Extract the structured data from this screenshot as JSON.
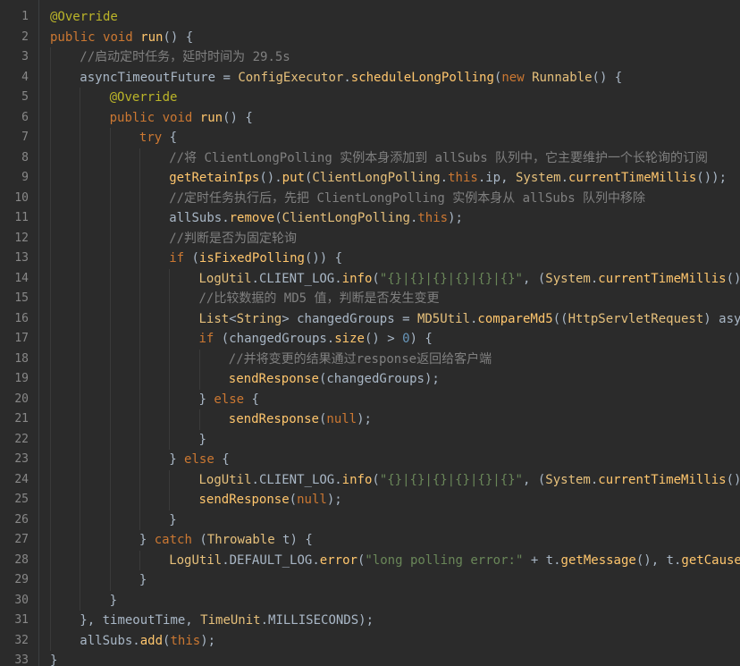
{
  "editor": {
    "colors": {
      "background": "#2b2b2b",
      "keyword": "#cc7832",
      "string": "#6a8759",
      "number": "#6897bb",
      "comment": "#808080",
      "method": "#ffc66d",
      "plain": "#a9b7c6"
    },
    "lines": [
      {
        "n": "1",
        "indent": 0,
        "tokens": [
          [
            "ann",
            "@Override"
          ]
        ]
      },
      {
        "n": "2",
        "indent": 0,
        "tokens": [
          [
            "kw",
            "public "
          ],
          [
            "kw",
            "void "
          ],
          [
            "fn",
            "run"
          ],
          [
            "pl",
            "() {"
          ]
        ]
      },
      {
        "n": "3",
        "indent": 1,
        "tokens": [
          [
            "cmt",
            "//启动定时任务，延时时间为 29.5s"
          ]
        ]
      },
      {
        "n": "4",
        "indent": 1,
        "tokens": [
          [
            "pl",
            "asyncTimeoutFuture = "
          ],
          [
            "cls",
            "ConfigExecutor"
          ],
          [
            "pl",
            "."
          ],
          [
            "fn",
            "scheduleLongPolling"
          ],
          [
            "pl",
            "("
          ],
          [
            "kw",
            "new "
          ],
          [
            "cls",
            "Runnable"
          ],
          [
            "pl",
            "() {"
          ]
        ]
      },
      {
        "n": "5",
        "indent": 2,
        "tokens": [
          [
            "ann",
            "@Override"
          ]
        ]
      },
      {
        "n": "6",
        "indent": 2,
        "tokens": [
          [
            "kw",
            "public "
          ],
          [
            "kw",
            "void "
          ],
          [
            "fn",
            "run"
          ],
          [
            "pl",
            "() {"
          ]
        ]
      },
      {
        "n": "7",
        "indent": 3,
        "tokens": [
          [
            "kw",
            "try "
          ],
          [
            "pl",
            "{"
          ]
        ]
      },
      {
        "n": "8",
        "indent": 4,
        "tokens": [
          [
            "cmt",
            "//将 ClientLongPolling 实例本身添加到 allSubs 队列中，它主要维护一个长轮询的订阅"
          ]
        ]
      },
      {
        "n": "9",
        "indent": 4,
        "tokens": [
          [
            "fn",
            "getRetainIps"
          ],
          [
            "pl",
            "()."
          ],
          [
            "fn",
            "put"
          ],
          [
            "pl",
            "("
          ],
          [
            "cls",
            "ClientLongPolling"
          ],
          [
            "pl",
            "."
          ],
          [
            "kw",
            "this"
          ],
          [
            "pl",
            ".ip, "
          ],
          [
            "cls",
            "System"
          ],
          [
            "pl",
            "."
          ],
          [
            "fn",
            "currentTimeMillis"
          ],
          [
            "pl",
            "());"
          ]
        ]
      },
      {
        "n": "10",
        "indent": 4,
        "tokens": [
          [
            "cmt",
            "//定时任务执行后，先把 ClientLongPolling 实例本身从 allSubs 队列中移除"
          ]
        ]
      },
      {
        "n": "11",
        "indent": 4,
        "tokens": [
          [
            "pl",
            "allSubs."
          ],
          [
            "fn",
            "remove"
          ],
          [
            "pl",
            "("
          ],
          [
            "cls",
            "ClientLongPolling"
          ],
          [
            "pl",
            "."
          ],
          [
            "kw",
            "this"
          ],
          [
            "pl",
            ");"
          ]
        ]
      },
      {
        "n": "12",
        "indent": 4,
        "tokens": [
          [
            "cmt",
            "//判断是否为固定轮询"
          ]
        ]
      },
      {
        "n": "13",
        "indent": 4,
        "tokens": [
          [
            "kw",
            "if "
          ],
          [
            "pl",
            "("
          ],
          [
            "fn",
            "isFixedPolling"
          ],
          [
            "pl",
            "()) {"
          ]
        ]
      },
      {
        "n": "14",
        "indent": 5,
        "tokens": [
          [
            "cls",
            "LogUtil"
          ],
          [
            "pl",
            ".CLIENT_LOG."
          ],
          [
            "fn",
            "info"
          ],
          [
            "pl",
            "("
          ],
          [
            "str",
            "\"{}|{}|{}|{}|{}|{}\""
          ],
          [
            "pl",
            ", ("
          ],
          [
            "cls",
            "System"
          ],
          [
            "pl",
            "."
          ],
          [
            "fn",
            "currentTimeMillis"
          ],
          [
            "pl",
            "() -"
          ]
        ]
      },
      {
        "n": "15",
        "indent": 5,
        "tokens": [
          [
            "cmt",
            "//比较数据的 MD5 值，判断是否发生变更"
          ]
        ]
      },
      {
        "n": "16",
        "indent": 5,
        "tokens": [
          [
            "cls",
            "List"
          ],
          [
            "pl",
            "<"
          ],
          [
            "cls",
            "String"
          ],
          [
            "pl",
            "> changedGroups = "
          ],
          [
            "cls",
            "MD5Util"
          ],
          [
            "pl",
            "."
          ],
          [
            "fn",
            "compareMd5"
          ],
          [
            "pl",
            "(("
          ],
          [
            "cls",
            "HttpServletRequest"
          ],
          [
            "pl",
            ") async"
          ]
        ]
      },
      {
        "n": "17",
        "indent": 5,
        "tokens": [
          [
            "kw",
            "if "
          ],
          [
            "pl",
            "(changedGroups."
          ],
          [
            "fn",
            "size"
          ],
          [
            "pl",
            "() > "
          ],
          [
            "num",
            "0"
          ],
          [
            "pl",
            ") {"
          ]
        ]
      },
      {
        "n": "18",
        "indent": 6,
        "tokens": [
          [
            "cmt",
            "//并将变更的结果通过response返回给客户端"
          ]
        ]
      },
      {
        "n": "19",
        "indent": 6,
        "tokens": [
          [
            "fn",
            "sendResponse"
          ],
          [
            "pl",
            "(changedGroups);"
          ]
        ]
      },
      {
        "n": "20",
        "indent": 5,
        "tokens": [
          [
            "pl",
            "} "
          ],
          [
            "kw",
            "else "
          ],
          [
            "pl",
            "{"
          ]
        ]
      },
      {
        "n": "21",
        "indent": 6,
        "tokens": [
          [
            "fn",
            "sendResponse"
          ],
          [
            "pl",
            "("
          ],
          [
            "kw",
            "null"
          ],
          [
            "pl",
            ");"
          ]
        ]
      },
      {
        "n": "22",
        "indent": 5,
        "tokens": [
          [
            "pl",
            "}"
          ]
        ]
      },
      {
        "n": "23",
        "indent": 4,
        "tokens": [
          [
            "pl",
            "} "
          ],
          [
            "kw",
            "else "
          ],
          [
            "pl",
            "{"
          ]
        ]
      },
      {
        "n": "24",
        "indent": 5,
        "tokens": [
          [
            "cls",
            "LogUtil"
          ],
          [
            "pl",
            ".CLIENT_LOG."
          ],
          [
            "fn",
            "info"
          ],
          [
            "pl",
            "("
          ],
          [
            "str",
            "\"{}|{}|{}|{}|{}|{}\""
          ],
          [
            "pl",
            ", ("
          ],
          [
            "cls",
            "System"
          ],
          [
            "pl",
            "."
          ],
          [
            "fn",
            "currentTimeMillis"
          ],
          [
            "pl",
            "() -"
          ]
        ]
      },
      {
        "n": "25",
        "indent": 5,
        "tokens": [
          [
            "fn",
            "sendResponse"
          ],
          [
            "pl",
            "("
          ],
          [
            "kw",
            "null"
          ],
          [
            "pl",
            ");"
          ]
        ]
      },
      {
        "n": "26",
        "indent": 4,
        "tokens": [
          [
            "pl",
            "}"
          ]
        ]
      },
      {
        "n": "27",
        "indent": 3,
        "tokens": [
          [
            "pl",
            "} "
          ],
          [
            "kw",
            "catch "
          ],
          [
            "pl",
            "("
          ],
          [
            "cls",
            "Throwable"
          ],
          [
            "pl",
            " t) {"
          ]
        ]
      },
      {
        "n": "28",
        "indent": 4,
        "tokens": [
          [
            "cls",
            "LogUtil"
          ],
          [
            "pl",
            ".DEFAULT_LOG."
          ],
          [
            "fn",
            "error"
          ],
          [
            "pl",
            "("
          ],
          [
            "str",
            "\"long polling error:\""
          ],
          [
            "pl",
            " + t."
          ],
          [
            "fn",
            "getMessage"
          ],
          [
            "pl",
            "(), t."
          ],
          [
            "fn",
            "getCause"
          ],
          [
            "pl",
            "()"
          ]
        ]
      },
      {
        "n": "29",
        "indent": 3,
        "tokens": [
          [
            "pl",
            "}"
          ]
        ]
      },
      {
        "n": "30",
        "indent": 2,
        "tokens": [
          [
            "pl",
            "}"
          ]
        ]
      },
      {
        "n": "31",
        "indent": 1,
        "tokens": [
          [
            "pl",
            "}, timeoutTime, "
          ],
          [
            "cls",
            "TimeUnit"
          ],
          [
            "pl",
            ".MILLISECONDS);"
          ]
        ]
      },
      {
        "n": "32",
        "indent": 1,
        "tokens": [
          [
            "pl",
            "allSubs."
          ],
          [
            "fn",
            "add"
          ],
          [
            "pl",
            "("
          ],
          [
            "kw",
            "this"
          ],
          [
            "pl",
            ");"
          ]
        ]
      },
      {
        "n": "33",
        "indent": 0,
        "tokens": [
          [
            "pl",
            "}"
          ]
        ]
      }
    ]
  }
}
